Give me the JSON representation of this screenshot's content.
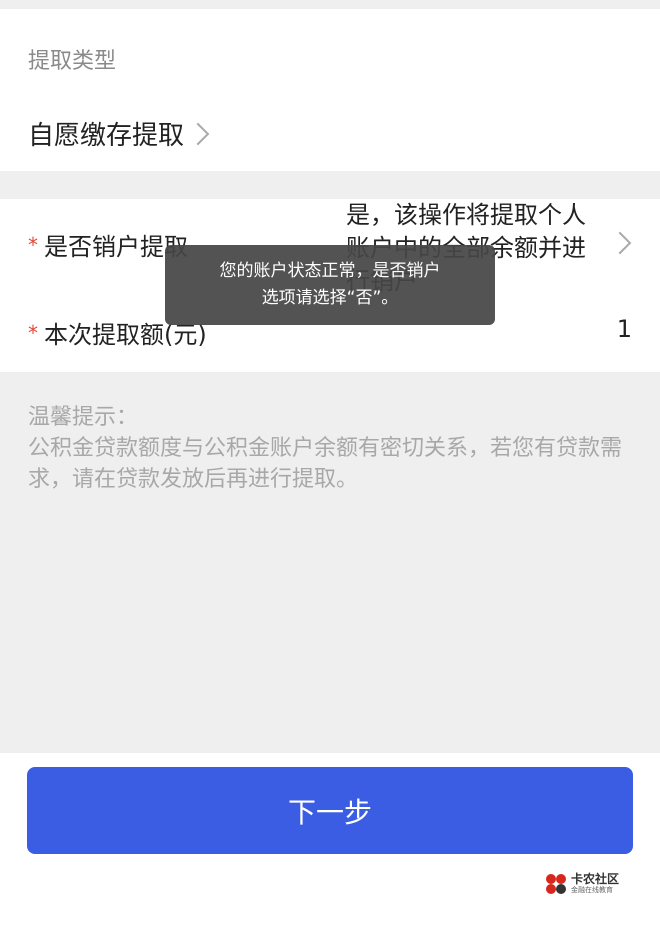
{
  "withdrawal_type": {
    "label": "提取类型",
    "value": "自愿缴存提取"
  },
  "close_account": {
    "label": "是否销户提取",
    "value": "是，该操作将提取个人账户中的全部余额并进行销户"
  },
  "amount": {
    "label": "本次提取额(元)",
    "value": "1"
  },
  "tips": {
    "title": "温馨提示：",
    "body": "公积金贷款额度与公积金账户余额有密切关系，若您有贷款需求，请在贷款发放后再进行提取。"
  },
  "toast": {
    "line1": "您的账户状态正常，是否销户",
    "line2": "选项请选择“否”。"
  },
  "buttons": {
    "next": "下一步"
  },
  "watermark": {
    "title": "卡农社区",
    "subtitle": "金融在线教育"
  },
  "colors": {
    "accent": "#3a5de4",
    "required": "#e0483a"
  }
}
